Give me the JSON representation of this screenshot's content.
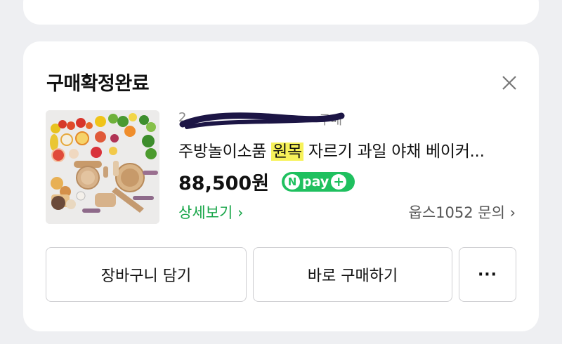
{
  "card": {
    "title": "구매확정완료",
    "order_meta_prefix": "2",
    "order_meta_suffix": "구매",
    "product": {
      "name_before": "주방놀이소품 ",
      "name_highlight": "원목",
      "name_after": " 자르기 과일 야채 베이커...",
      "price": "88,500원",
      "npay_label": "pay"
    },
    "detail_link": "상세보기 ›",
    "seller_link": "웁스1052 문의 ›"
  },
  "actions": {
    "cart": "장바구니 담기",
    "buy": "바로 구매하기",
    "more": "···"
  },
  "colors": {
    "accent_green": "#1aa64a",
    "npay_green": "#1fc05f",
    "highlight": "#f7f25a"
  }
}
